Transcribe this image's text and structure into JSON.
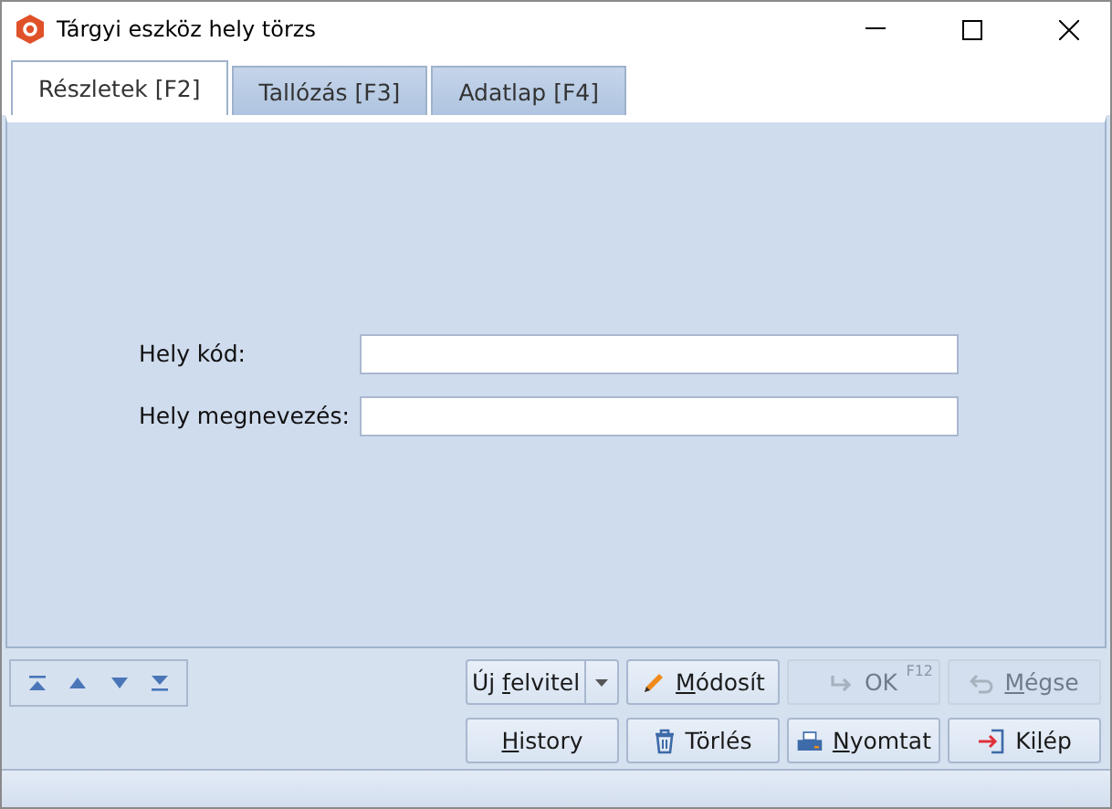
{
  "window": {
    "title": "Tárgyi eszköz hely törzs"
  },
  "tabs": [
    {
      "label": "Részletek [F2]",
      "selected": true
    },
    {
      "label": "Tallózás [F3]",
      "selected": false
    },
    {
      "label": "Adatlap [F4]",
      "selected": false
    }
  ],
  "fields": [
    {
      "label": "Hely kód:"
    },
    {
      "label": "Hely megnevezés:"
    }
  ],
  "buttons": [
    [
      {
        "kind": "split",
        "label": {
          "before": "Új ",
          "key": "f",
          "after": "elvitel"
        },
        "disabled": false
      },
      {
        "kind": "edit",
        "label": {
          "key": "M",
          "after": "ódosít"
        },
        "disabled": false
      },
      {
        "kind": "confirm",
        "label": {
          "after": "OK"
        },
        "disabled": true,
        "shortcut": "F12"
      },
      {
        "kind": "cancel",
        "label": {
          "key": "M",
          "after": "égse"
        },
        "disabled": true
      }
    ],
    [
      {
        "kind": "plain",
        "label": {
          "key": "H",
          "after": "istory"
        },
        "disabled": false
      },
      {
        "kind": "delete",
        "label": {
          "after": "Törlés"
        },
        "disabled": false
      },
      {
        "kind": "print",
        "label": {
          "key": "N",
          "after": "yomtat"
        },
        "disabled": false
      },
      {
        "kind": "exit",
        "label": {
          "before": "Ki",
          "key": "l",
          "after": "ép"
        },
        "disabled": false
      }
    ]
  ]
}
